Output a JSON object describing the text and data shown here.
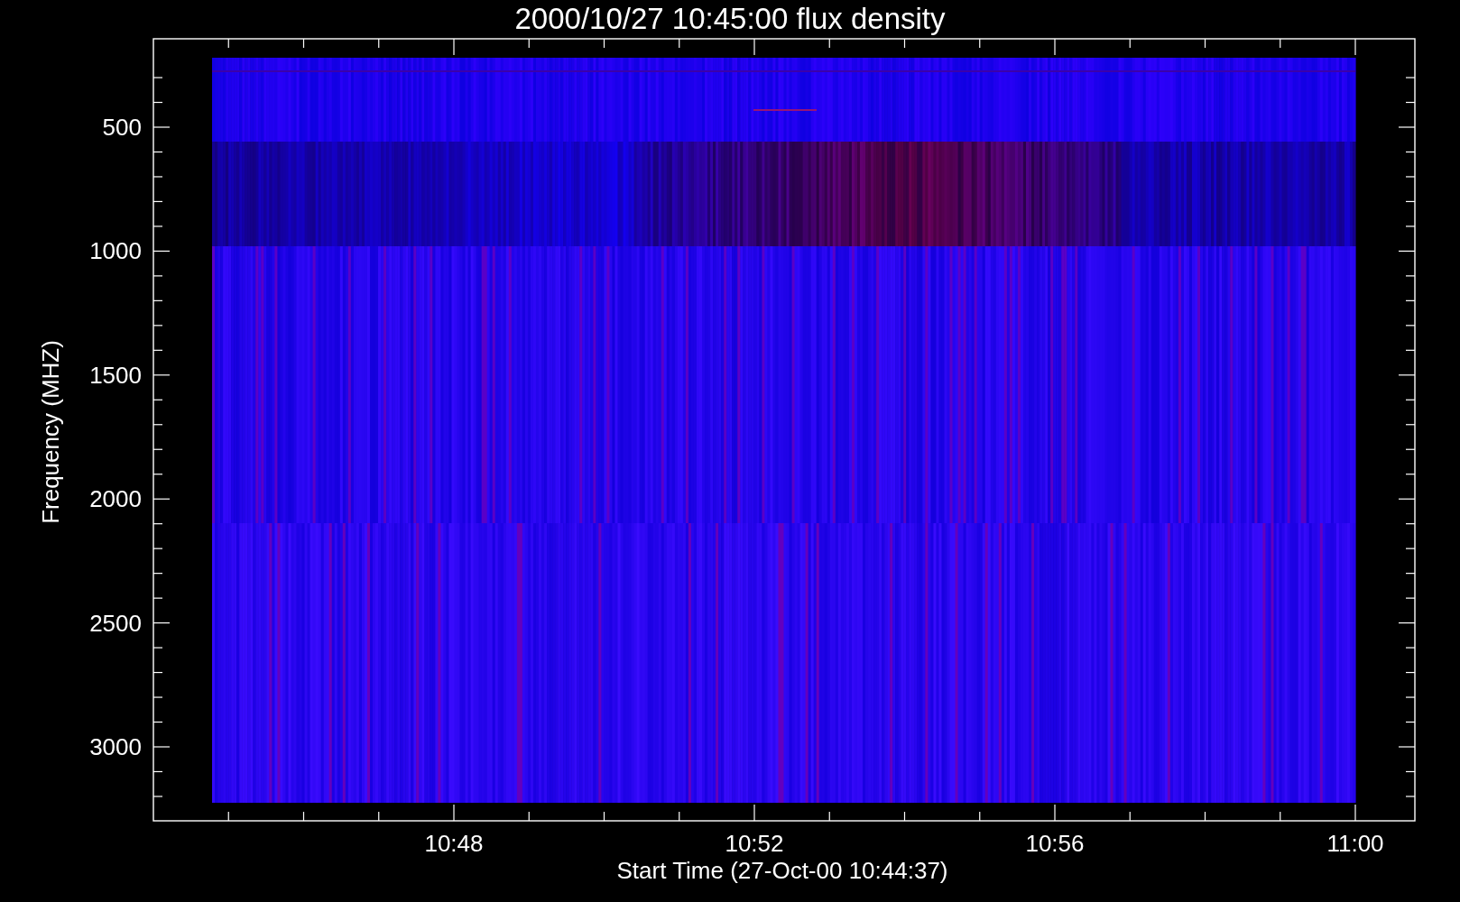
{
  "plot": {
    "title": "2000/10/27 10:45:00 flux density",
    "ylabel": "Frequency (MHZ)",
    "xlabel": "Start Time (27-Oct-00 10:44:37)",
    "yticks": [
      "500",
      "1000",
      "1500",
      "2000",
      "2500",
      "3000"
    ],
    "xticks": [
      "10:48",
      "10:52",
      "10:56",
      "11:00"
    ]
  }
}
